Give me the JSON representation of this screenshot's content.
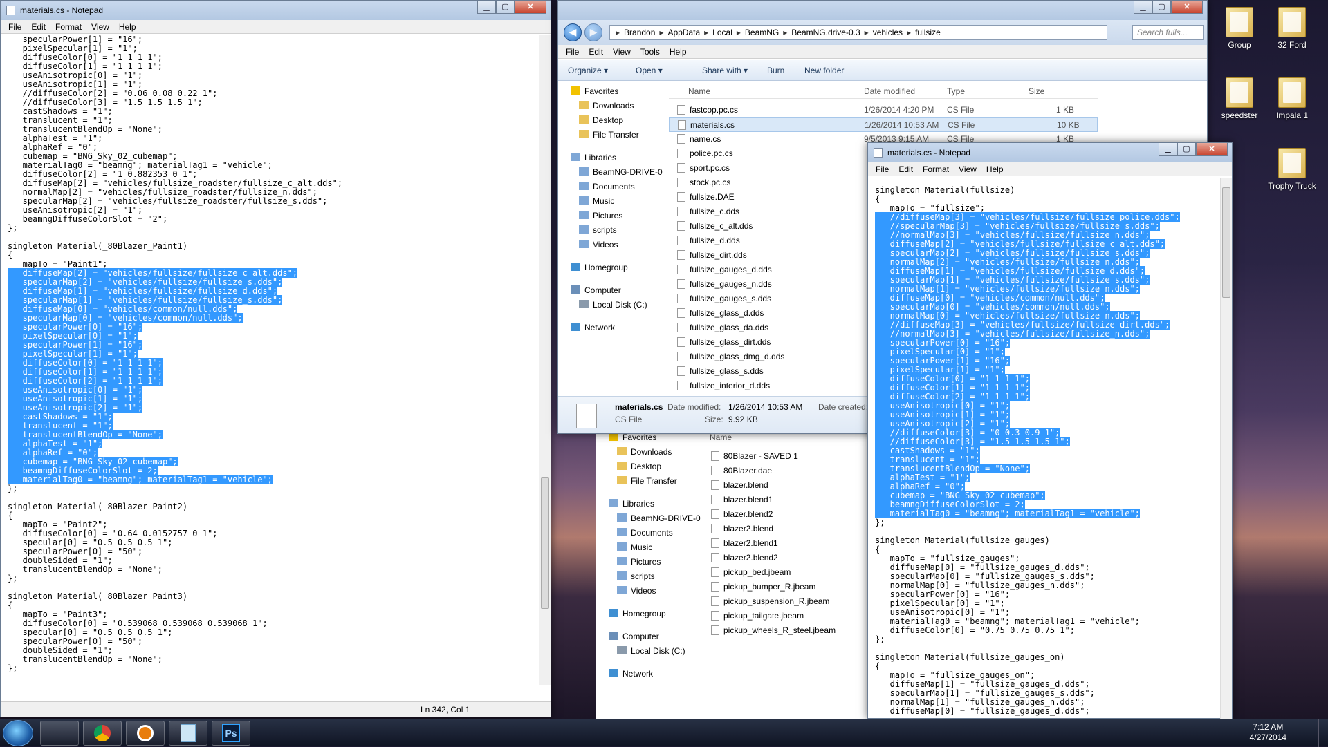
{
  "desktop": {
    "icons": [
      "Group",
      "32 Ford",
      "speedster",
      "Impala 1",
      "Trophy Truck"
    ]
  },
  "notepad_left": {
    "title": "materials.cs - Notepad",
    "menu": [
      "File",
      "Edit",
      "Format",
      "View",
      "Help"
    ],
    "status": "Ln 342, Col 1",
    "lines": [
      "   specularPower[1] = \"16\";",
      "   pixelSpecular[1] = \"1\";",
      "   diffuseColor[0] = \"1 1 1 1\";",
      "   diffuseColor[1] = \"1 1 1 1\";",
      "   useAnisotropic[0] = \"1\";",
      "   useAnisotropic[1] = \"1\";",
      "   //diffuseColor[2] = \"0.06 0.08 0.22 1\";",
      "   //diffuseColor[3] = \"1.5 1.5 1.5 1\";",
      "   castShadows = \"1\";",
      "   translucent = \"1\";",
      "   translucentBlendOp = \"None\";",
      "   alphaTest = \"1\";",
      "   alphaRef = \"0\";",
      "   cubemap = \"BNG_Sky_02_cubemap\";",
      "   materialTag0 = \"beamng\"; materialTag1 = \"vehicle\";",
      "   diffuseColor[2] = \"1 0.882353 0 1\";",
      "   diffuseMap[2] = \"vehicles/fullsize_roadster/fullsize_c_alt.dds\";",
      "   normalMap[2] = \"vehicles/fullsize_roadster/fullsize_n.dds\";",
      "   specularMap[2] = \"vehicles/fullsize_roadster/fullsize_s.dds\";",
      "   useAnisotropic[2] = \"1\";",
      "   beamngDiffuseColorSlot = \"2\";",
      "};",
      "",
      "singleton Material(_80Blazer_Paint1)",
      "{",
      "   mapTo = \"Paint1\";",
      "   diffuseMap[2] = \"vehicles/fullsize/fullsize_c_alt.dds\";",
      "   specularMap[2] = \"vehicles/fullsize/fullsize_s.dds\";",
      "   diffuseMap[1] = \"vehicles/fullsize/fullsize_d.dds\";",
      "   specularMap[1] = \"vehicles/fullsize/fullsize_s.dds\";",
      "   diffuseMap[0] = \"vehicles/common/null.dds\";",
      "   specularMap[0] = \"vehicles/common/null.dds\";",
      "   specularPower[0] = \"16\";",
      "   pixelSpecular[0] = \"1\";",
      "   specularPower[1] = \"16\";",
      "   pixelSpecular[1] = \"1\";",
      "   diffuseColor[0] = \"1 1 1 1\";",
      "   diffuseColor[1] = \"1 1 1 1\";",
      "   diffuseColor[2] = \"1 1 1 1\";",
      "   useAnisotropic[0] = \"1\";",
      "   useAnisotropic[1] = \"1\";",
      "   useAnisotropic[2] = \"1\";",
      "   castShadows = \"1\";",
      "   translucent = \"1\";",
      "   translucentBlendOp = \"None\";",
      "   alphaTest = \"1\";",
      "   alphaRef = \"0\";",
      "   cubemap = \"BNG_Sky_02_cubemap\";",
      "   beamngDiffuseColorSlot = 2;",
      "   materialTag0 = \"beamng\"; materialTag1 = \"vehicle\";",
      "};",
      "",
      "singleton Material(_80Blazer_Paint2)",
      "{",
      "   mapTo = \"Paint2\";",
      "   diffuseColor[0] = \"0.64 0.0152757 0 1\";",
      "   specular[0] = \"0.5 0.5 0.5 1\";",
      "   specularPower[0] = \"50\";",
      "   doubleSided = \"1\";",
      "   translucentBlendOp = \"None\";",
      "};",
      "",
      "singleton Material(_80Blazer_Paint3)",
      "{",
      "   mapTo = \"Paint3\";",
      "   diffuseColor[0] = \"0.539068 0.539068 0.539068 1\";",
      "   specular[0] = \"0.5 0.5 0.5 1\";",
      "   specularPower[0] = \"50\";",
      "   doubleSided = \"1\";",
      "   translucentBlendOp = \"None\";",
      "};"
    ],
    "selected_from": 26,
    "selected_to": 49
  },
  "explorer": {
    "breadcrumb": [
      "Brandon",
      "AppData",
      "Local",
      "BeamNG",
      "BeamNG.drive-0.3",
      "vehicles",
      "fullsize"
    ],
    "search_placeholder": "Search fulls...",
    "menu": [
      "File",
      "Edit",
      "View",
      "Tools",
      "Help"
    ],
    "toolbar": [
      "Organize ▾",
      "Open ▾",
      "Share with ▾",
      "Burn",
      "New folder"
    ],
    "nav": [
      {
        "label": "Favorites",
        "kind": "star"
      },
      {
        "label": "Downloads",
        "kind": "folder"
      },
      {
        "label": "Desktop",
        "kind": "folder"
      },
      {
        "label": "File Transfer",
        "kind": "folder"
      },
      {
        "label": "Libraries",
        "kind": "lib"
      },
      {
        "label": "BeamNG-DRIVE-0",
        "kind": "lib"
      },
      {
        "label": "Documents",
        "kind": "lib"
      },
      {
        "label": "Music",
        "kind": "lib"
      },
      {
        "label": "Pictures",
        "kind": "lib"
      },
      {
        "label": "scripts",
        "kind": "lib"
      },
      {
        "label": "Videos",
        "kind": "lib"
      },
      {
        "label": "Homegroup",
        "kind": "net"
      },
      {
        "label": "Computer",
        "kind": "pc"
      },
      {
        "label": "Local Disk (C:)",
        "kind": "disk"
      },
      {
        "label": "Network",
        "kind": "net"
      }
    ],
    "columns": [
      "Name",
      "Date modified",
      "Type",
      "Size"
    ],
    "files": [
      {
        "name": "fastcop.pc.cs",
        "date": "1/26/2014 4:20 PM",
        "type": "CS File",
        "size": "1 KB"
      },
      {
        "name": "materials.cs",
        "date": "1/26/2014 10:53 AM",
        "type": "CS File",
        "size": "10 KB"
      },
      {
        "name": "name.cs",
        "date": "9/5/2013 9:15 AM",
        "type": "CS File",
        "size": "1 KB"
      },
      {
        "name": "police.pc.cs",
        "date": "",
        "type": "",
        "size": ""
      },
      {
        "name": "sport.pc.cs",
        "date": "",
        "type": "",
        "size": ""
      },
      {
        "name": "stock.pc.cs",
        "date": "",
        "type": "",
        "size": ""
      },
      {
        "name": "fullsize.DAE",
        "date": "",
        "type": "",
        "size": ""
      },
      {
        "name": "fullsize_c.dds",
        "date": "",
        "type": "",
        "size": ""
      },
      {
        "name": "fullsize_c_alt.dds",
        "date": "",
        "type": "",
        "size": ""
      },
      {
        "name": "fullsize_d.dds",
        "date": "",
        "type": "",
        "size": ""
      },
      {
        "name": "fullsize_dirt.dds",
        "date": "",
        "type": "",
        "size": ""
      },
      {
        "name": "fullsize_gauges_d.dds",
        "date": "",
        "type": "",
        "size": ""
      },
      {
        "name": "fullsize_gauges_n.dds",
        "date": "",
        "type": "",
        "size": ""
      },
      {
        "name": "fullsize_gauges_s.dds",
        "date": "",
        "type": "",
        "size": ""
      },
      {
        "name": "fullsize_glass_d.dds",
        "date": "",
        "type": "",
        "size": ""
      },
      {
        "name": "fullsize_glass_da.dds",
        "date": "",
        "type": "",
        "size": ""
      },
      {
        "name": "fullsize_glass_dirt.dds",
        "date": "",
        "type": "",
        "size": ""
      },
      {
        "name": "fullsize_glass_dmg_d.dds",
        "date": "",
        "type": "",
        "size": ""
      },
      {
        "name": "fullsize_glass_s.dds",
        "date": "",
        "type": "",
        "size": ""
      },
      {
        "name": "fullsize_interior_d.dds",
        "date": "",
        "type": "",
        "size": ""
      }
    ],
    "details": {
      "name": "materials.cs",
      "type": "CS File",
      "date_modified_label": "Date modified:",
      "date_modified": "1/26/2014 10:53 AM",
      "size_label": "Size:",
      "size": "9.92 KB",
      "date_created_label": "Date created:"
    }
  },
  "explorer2": {
    "nav": [
      {
        "label": "Favorites",
        "kind": "star"
      },
      {
        "label": "Downloads",
        "kind": "folder"
      },
      {
        "label": "Desktop",
        "kind": "folder"
      },
      {
        "label": "File Transfer",
        "kind": "folder"
      },
      {
        "label": "Libraries",
        "kind": "lib"
      },
      {
        "label": "BeamNG-DRIVE-0",
        "kind": "lib"
      },
      {
        "label": "Documents",
        "kind": "lib"
      },
      {
        "label": "Music",
        "kind": "lib"
      },
      {
        "label": "Pictures",
        "kind": "lib"
      },
      {
        "label": "scripts",
        "kind": "lib"
      },
      {
        "label": "Videos",
        "kind": "lib"
      },
      {
        "label": "Homegroup",
        "kind": "net"
      },
      {
        "label": "Computer",
        "kind": "pc"
      },
      {
        "label": "Local Disk (C:)",
        "kind": "disk"
      },
      {
        "label": "Network",
        "kind": "net"
      }
    ],
    "name_header": "Name",
    "files": [
      "80Blazer - SAVED 1",
      "80Blazer.dae",
      "blazer.blend",
      "blazer.blend1",
      "blazer.blend2",
      "blazer2.blend",
      "blazer2.blend1",
      "blazer2.blend2",
      "pickup_bed.jbeam",
      "pickup_bumper_R.jbeam",
      "pickup_suspension_R.jbeam",
      "pickup_tailgate.jbeam",
      "pickup_wheels_R_steel.jbeam"
    ]
  },
  "notepad_right": {
    "title": "materials.cs - Notepad",
    "menu": [
      "File",
      "Edit",
      "Format",
      "View",
      "Help"
    ],
    "lines": [
      "singleton Material(fullsize)",
      "{",
      "   mapTo = \"fullsize\";",
      "   //diffuseMap[3] = \"vehicles/fullsize/fullsize_police.dds\";",
      "   //specularMap[3] = \"vehicles/fullsize/fullsize_s.dds\";",
      "   //normalMap[3] = \"vehicles/fullsize/fullsize_n.dds\";",
      "   diffuseMap[2] = \"vehicles/fullsize/fullsize_c_alt.dds\";",
      "   specularMap[2] = \"vehicles/fullsize/fullsize_s.dds\";",
      "   normalMap[2] = \"vehicles/fullsize/fullsize_n.dds\";",
      "   diffuseMap[1] = \"vehicles/fullsize/fullsize_d.dds\";",
      "   specularMap[1] = \"vehicles/fullsize/fullsize_s.dds\";",
      "   normalMap[1] = \"vehicles/fullsize/fullsize_n.dds\";",
      "   diffuseMap[0] = \"vehicles/common/null.dds\";",
      "   specularMap[0] = \"vehicles/common/null.dds\";",
      "   normalMap[0] = \"vehicles/fullsize/fullsize_n.dds\";",
      "   //diffuseMap[3] = \"vehicles/fullsize/fullsize_dirt.dds\";",
      "   //normalMap[3] = \"vehicles/fullsize/fullsize_n.dds\";",
      "   specularPower[0] = \"16\";",
      "   pixelSpecular[0] = \"1\";",
      "   specularPower[1] = \"16\";",
      "   pixelSpecular[1] = \"1\";",
      "   diffuseColor[0] = \"1 1 1 1\";",
      "   diffuseColor[1] = \"1 1 1 1\";",
      "   diffuseColor[2] = \"1 1 1 1\";",
      "   useAnisotropic[0] = \"1\";",
      "   useAnisotropic[1] = \"1\";",
      "   useAnisotropic[2] = \"1\";",
      "   //diffuseColor[3] = \"0 0.3 0.9 1\";",
      "   //diffuseColor[3] = \"1.5 1.5 1.5 1\";",
      "   castShadows = \"1\";",
      "   translucent = \"1\";",
      "   translucentBlendOp = \"None\";",
      "   alphaTest = \"1\";",
      "   alphaRef = \"0\";",
      "   cubemap = \"BNG_Sky_02_cubemap\";",
      "   beamngDiffuseColorSlot = 2;",
      "   materialTag0 = \"beamng\"; materialTag1 = \"vehicle\";",
      "};",
      "",
      "singleton Material(fullsize_gauges)",
      "{",
      "   mapTo = \"fullsize_gauges\";",
      "   diffuseMap[0] = \"fullsize_gauges_d.dds\";",
      "   specularMap[0] = \"fullsize_gauges_s.dds\";",
      "   normalMap[0] = \"fullsize_gauges_n.dds\";",
      "   specularPower[0] = \"16\";",
      "   pixelSpecular[0] = \"1\";",
      "   useAnisotropic[0] = \"1\";",
      "   materialTag0 = \"beamng\"; materialTag1 = \"vehicle\";",
      "   diffuseColor[0] = \"0.75 0.75 0.75 1\";",
      "};",
      "",
      "singleton Material(fullsize_gauges_on)",
      "{",
      "   mapTo = \"fullsize_gauges_on\";",
      "   diffuseMap[1] = \"fullsize_gauges_d.dds\";",
      "   specularMap[1] = \"fullsize_gauges_s.dds\";",
      "   normalMap[1] = \"fullsize_gauges_n.dds\";",
      "   diffuseMap[0] = \"fullsize_gauges_d.dds\";"
    ],
    "selected_from": 3,
    "selected_to": 36
  },
  "taskbar": {
    "time": "7:12 AM",
    "date": "4/27/2014"
  }
}
